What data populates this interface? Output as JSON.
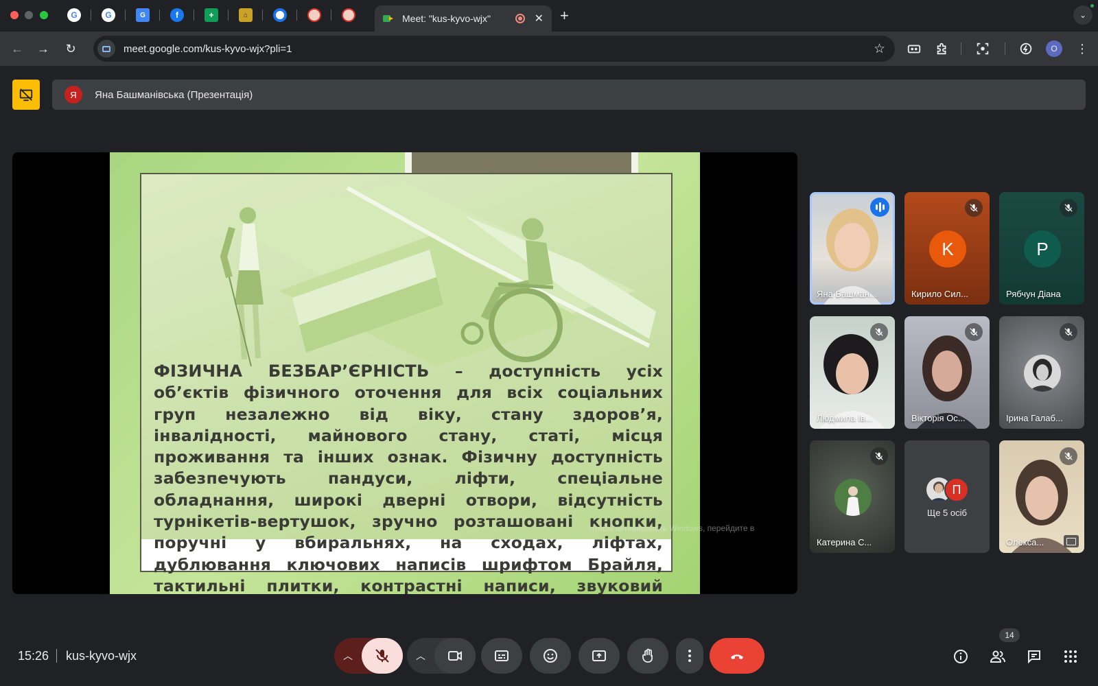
{
  "browser": {
    "active_tab": {
      "title": "Meet: \"kus-kyvo-wjx\""
    },
    "address": {
      "url": "meet.google.com/kus-kyvo-wjx?pli=1"
    },
    "profile_initial": "O"
  },
  "meet": {
    "presenter": {
      "initial": "Я",
      "label": "Яна Башманівська (Презентація)"
    },
    "slide": {
      "term": "ФІЗИЧНА БЕЗБАР’ЄРНІСТЬ",
      "text": " – доступність усіх об’єктів фізичного оточення для всіх соціальних груп незалежно від віку, стану здоров’я, інвалідності, майнового стану, статі, місця проживання та інших ознак. Фізичну доступність забезпечують пандуси, ліфти, спеціальне обладнання, широкі дверні отвори, відсутність турнікетів-вертушок, зручно розташовані кнопки, поручні у вбиральнях, на сходах, ліфтах, дублювання ключових написів шрифтом Брайля, тактильні плитки, контрастні написи, звуковий сигнал світлофора)."
    },
    "watermark": "Чтобы активировать Windows, перейдите в",
    "participants": [
      {
        "name": "Яна Башман...",
        "speaking": true
      },
      {
        "name": "Кирило Сил...",
        "initial": "K",
        "color": "#e8590c"
      },
      {
        "name": "Рябчун Діана",
        "initial": "P",
        "color": "#0f5c4e"
      },
      {
        "name": "Людмила Ів..."
      },
      {
        "name": "Вікторія Ос..."
      },
      {
        "name": "Ірина Галаб..."
      },
      {
        "name": "Катерина С..."
      },
      {
        "more_label": "Ще 5 осіб",
        "initial": "П",
        "color": "#d93025"
      },
      {
        "name": "Олекса..."
      }
    ],
    "footer": {
      "time": "15:26",
      "meeting_code": "kus-kyvo-wjx",
      "people_count": "14"
    }
  },
  "colors": {
    "speaking_outline": "#a8c7fa",
    "end_call": "#ea4335",
    "mic_muted_bg": "#f9dedc",
    "presentation_icon_bg": "#fbbc04"
  }
}
